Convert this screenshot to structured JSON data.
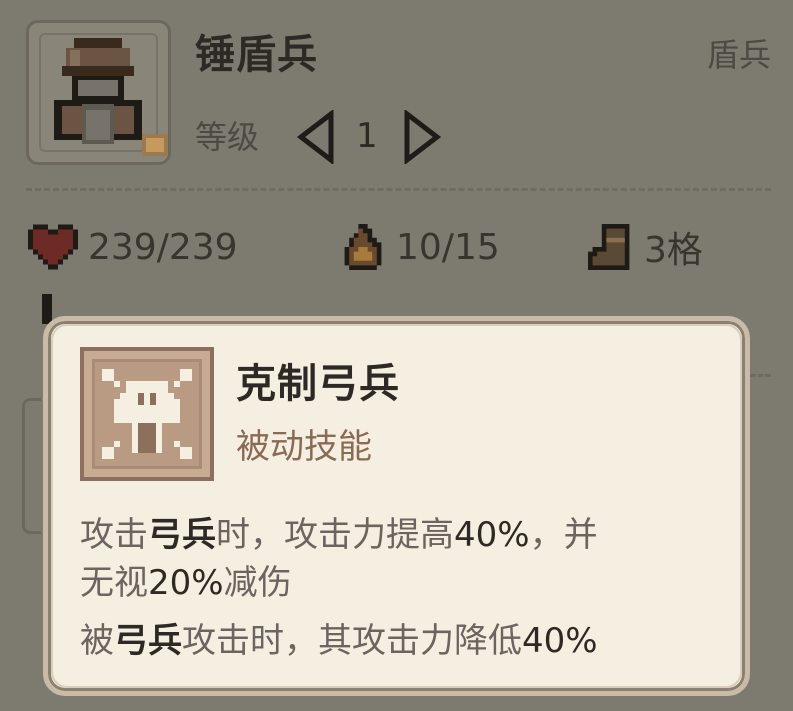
{
  "unit": {
    "name": "锤盾兵",
    "class_label": "盾兵",
    "level_label": "等级",
    "level": "1"
  },
  "stats": {
    "hp": "239/239",
    "energy": "10/15",
    "move": "3格"
  },
  "tooltip": {
    "skill_name": "克制弓兵",
    "skill_type": "被动技能",
    "line1_a": "攻击",
    "line1_b": "弓兵",
    "line1_c": "时，攻击力提高",
    "line1_d": "40%",
    "line1_e": "，并",
    "line2_a": "无视",
    "line2_b": "20%",
    "line2_c": "减伤",
    "line3_a": "被",
    "line3_b": "弓兵",
    "line3_c": "攻击时，其攻击力降低",
    "line3_d": "40%"
  },
  "colors": {
    "dim_overlay": "#7d7a70",
    "tooltip_bg": "#f5efe2",
    "skill_type": "#8a6a55",
    "heart": "#6e2a24",
    "fire": "#6a4a2c",
    "boot": "#5a4a35"
  }
}
